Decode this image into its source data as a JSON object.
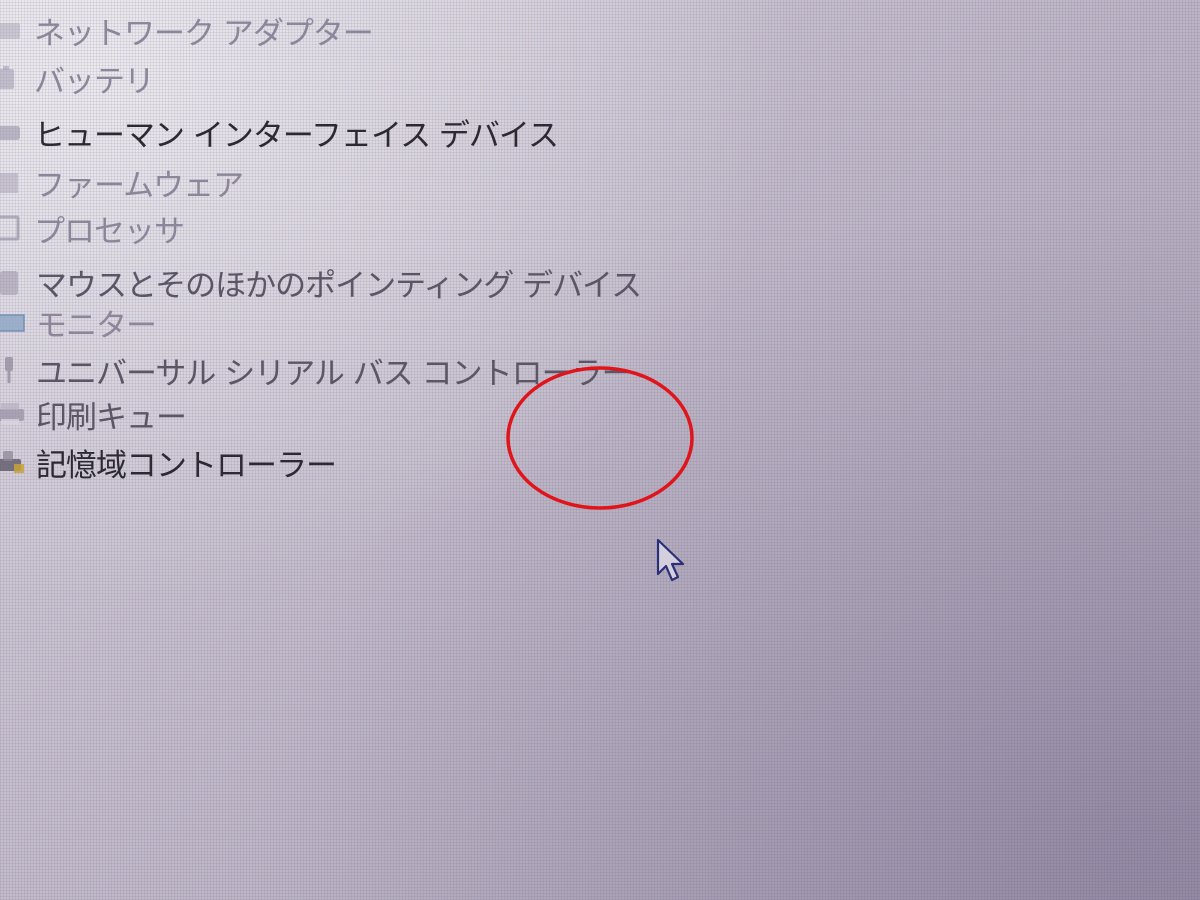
{
  "device_manager": {
    "categories": [
      {
        "label": "ネットワーク アダプター",
        "icon": "network-adapter-icon"
      },
      {
        "label": "バッテリ",
        "icon": "battery-icon"
      },
      {
        "label": "ヒューマン インターフェイス デバイス",
        "icon": "human-interface-device-icon"
      },
      {
        "label": "ファームウェア",
        "icon": "firmware-icon"
      },
      {
        "label": "プロセッサ",
        "icon": "processor-icon"
      },
      {
        "label": "マウスとそのほかのポインティング デバイス",
        "icon": "mouse-icon"
      },
      {
        "label": "モニター",
        "icon": "monitor-icon"
      },
      {
        "label": "ユニバーサル シリアル バス コントローラー",
        "icon": "usb-controller-icon"
      },
      {
        "label": "印刷キュー",
        "icon": "printer-icon"
      },
      {
        "label": "記憶域コントローラー",
        "icon": "storage-controller-icon"
      }
    ]
  },
  "annotation": {
    "shape": "ellipse",
    "color": "#e0151c"
  },
  "colors": {
    "screen_background": "#c4bdcc",
    "text": "#3c3844",
    "cursor_outline": "#2b2f7a"
  }
}
